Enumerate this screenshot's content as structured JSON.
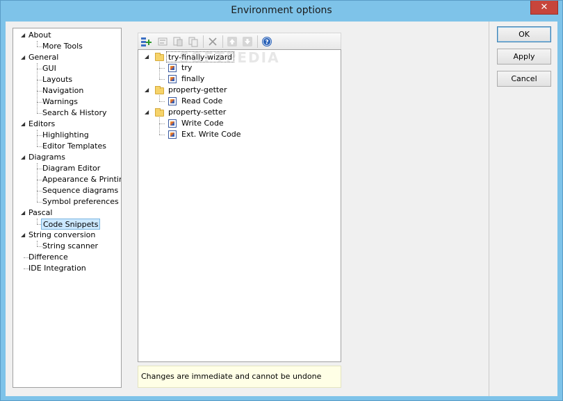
{
  "window": {
    "title": "Environment options",
    "close_glyph": "✕"
  },
  "nav_tree": [
    {
      "label": "About",
      "children": [
        "More Tools"
      ]
    },
    {
      "label": "General",
      "children": [
        "GUI",
        "Layouts",
        "Navigation",
        "Warnings",
        "Search & History"
      ]
    },
    {
      "label": "Editors",
      "children": [
        "Highlighting",
        "Editor Templates"
      ]
    },
    {
      "label": "Diagrams",
      "children": [
        "Diagram Editor",
        "Appearance & Printing",
        "Sequence diagrams",
        "Symbol preferences"
      ]
    },
    {
      "label": "Pascal",
      "children": [
        "Code Snippets"
      ]
    },
    {
      "label": "String conversion",
      "children": [
        "String scanner"
      ]
    },
    {
      "label": "Difference",
      "children": []
    },
    {
      "label": "IDE Integration",
      "children": []
    }
  ],
  "selected_nav": "Code Snippets",
  "buttons": {
    "ok": "OK",
    "apply": "Apply",
    "cancel": "Cancel"
  },
  "snippets": [
    {
      "label": "try-finally-wizard",
      "items": [
        "try",
        "finally"
      ]
    },
    {
      "label": "property-getter",
      "items": [
        "Read Code"
      ]
    },
    {
      "label": "property-setter",
      "items": [
        "Write Code",
        "Ext. Write Code"
      ]
    }
  ],
  "status": {
    "message": "Changes are immediate and cannot be undone"
  },
  "watermark": "SOFTPEDIA",
  "colors": {
    "accent": "#7ec3e9",
    "selection": "#cce8ff",
    "status_bg": "#ffffe6"
  }
}
